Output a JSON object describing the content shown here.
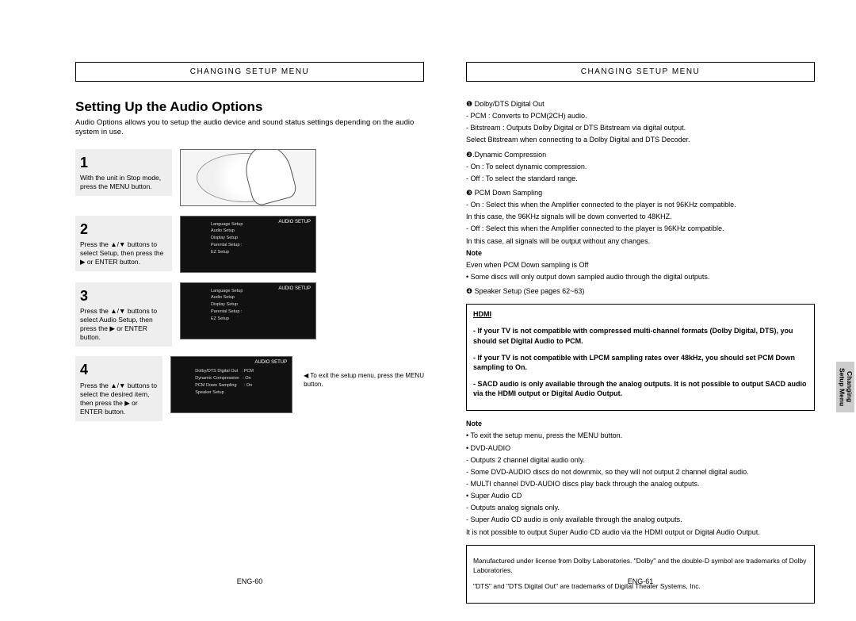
{
  "header_left": "CHANGING SETUP MENU",
  "header_right": "CHANGING SETUP MENU",
  "title": "Setting Up the Audio Options",
  "intro": "Audio Options allows you to setup the audio device and sound status settings depending on the audio system in use.",
  "steps": [
    {
      "num": "1",
      "text": "With the unit in Stop mode, press the MENU button."
    },
    {
      "num": "2",
      "text": "Press the ▲/▼ buttons to select Setup, then press the ▶ or ENTER button."
    },
    {
      "num": "3",
      "text": "Press the ▲/▼ buttons to select Audio Setup, then press the ▶ or ENTER button."
    },
    {
      "num": "4",
      "text": "Press the ▲/▼ buttons to select the desired item, then press the ▶ or ENTER button."
    }
  ],
  "menu_items_setup": "Language Setup\nAudio Setup\nDisplay Setup\nParental Setup :\nEZ Setup",
  "menu_items_audio": "Dolby/DTS Digital Out   : PCM\nDynamic Compression   : On\nPCM Down Sampling      : On\nSpeaker Setup",
  "exit_note": "To exit the setup menu, press the MENU button.",
  "right": {
    "opt1_title": "❶ Dolby/DTS Digital Out",
    "opt1_a": "- PCM : Converts to PCM(2CH) audio.",
    "opt1_b": "- Bitstream : Outputs Dolby Digital or DTS Bitstream via digital output.",
    "opt1_b2": "Select Bitstream when connecting to a Dolby Digital and DTS Decoder.",
    "opt2_title": "❷.Dynamic Compression",
    "opt2_a": "- On : To select dynamic compression.",
    "opt2_b": "- Off : To select the standard range.",
    "opt3_title": "❸ PCM Down Sampling",
    "opt3_a": "- On : Select this when the Amplifier connected to the player is not 96KHz compatible.",
    "opt3_a2": "In this case, the 96KHz signals will be down converted to 48KHZ.",
    "opt3_b": "- Off : Select this when the Amplifier connected to the player is 96KHz compatible.",
    "opt3_b2": "In this case, all signals will be output without any changes.",
    "note1_title": "Note",
    "note1_a": "Even when PCM Down sampling is Off",
    "note1_b": "• Some discs will only output down sampled audio through the digital outputs.",
    "opt4": "❹ Speaker Setup (See pages 62~63)",
    "hdmi_label": "HDMI",
    "hdmi_a": "- If your TV is not compatible with compressed multi-channel formats (Dolby Digital, DTS), you should set Digital Audio to PCM.",
    "hdmi_b": "- If your TV is not compatible with LPCM sampling rates over 48kHz, you should set PCM Down sampling to On.",
    "hdmi_c": "- SACD audio is only available through the analog outputs. It is not possible to output SACD audio via the HDMI output or Digital Audio Output.",
    "note2_title": "Note",
    "note2_a": "• To exit the setup menu, press the MENU button.",
    "note2_b": "• DVD-AUDIO",
    "note2_b1": "- Outputs 2 channel digital audio only.",
    "note2_b2": "- Some DVD-AUDIO discs do not downmix, so they will not output 2 channel digital audio.",
    "note2_b3": "- MULTI channel DVD-AUDIO discs play back through the analog outputs.",
    "note2_c": "• Super Audio CD",
    "note2_c1": "- Outputs analog signals only.",
    "note2_c2": "- Super Audio CD audio is only available through the analog outputs.",
    "note2_c3": "It is not possible to output Super Audio CD audio via the HDMI output or Digital Audio Output.",
    "legal_a": "Manufactured under license from Dolby Laboratories. \"Dolby\" and the double-D symbol are trademarks of Dolby Laboratories.",
    "legal_b": "\"DTS\" and \"DTS Digital Out\" are trademarks of Digital Theater Systems, Inc."
  },
  "side_tab": "Changing\nSetup Menu",
  "pg_left": "ENG-60",
  "pg_right": "ENG-61"
}
